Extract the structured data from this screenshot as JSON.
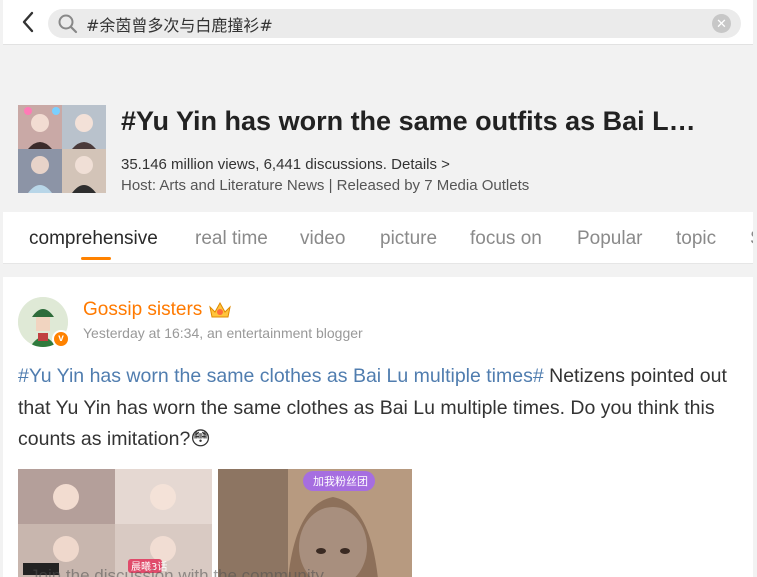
{
  "search": {
    "query": "#余茵曾多次与白鹿撞衫#"
  },
  "topic": {
    "title": "#Yu Yin has worn the same outfits as Bai L…",
    "stats": "35.146 million views, 6,441 discussions. Details >",
    "host": "Host: Arts and Literature News | Released by 7 Media Outlets"
  },
  "tabs": [
    "comprehensive",
    "real time",
    "video",
    "picture",
    "focus on",
    "Popular",
    "topic",
    "S"
  ],
  "active_tab": "comprehensive",
  "post": {
    "author": "Gossip sisters",
    "time": "Yesterday at 16:34, an entertainment blogger",
    "verified_badge": "v",
    "hashtag": "#Yu Yin has worn the same clothes as Bai Lu multiple times#",
    "body": " Netizens pointed out that Yu Yin has worn the same clothes as Bai Lu multiple times. Do you think this counts as imitation?",
    "emoji": "😳",
    "img1_caption": "晨曦3话",
    "img2_banner": "加我粉丝团"
  },
  "overlay": "Join the discussion with the community"
}
